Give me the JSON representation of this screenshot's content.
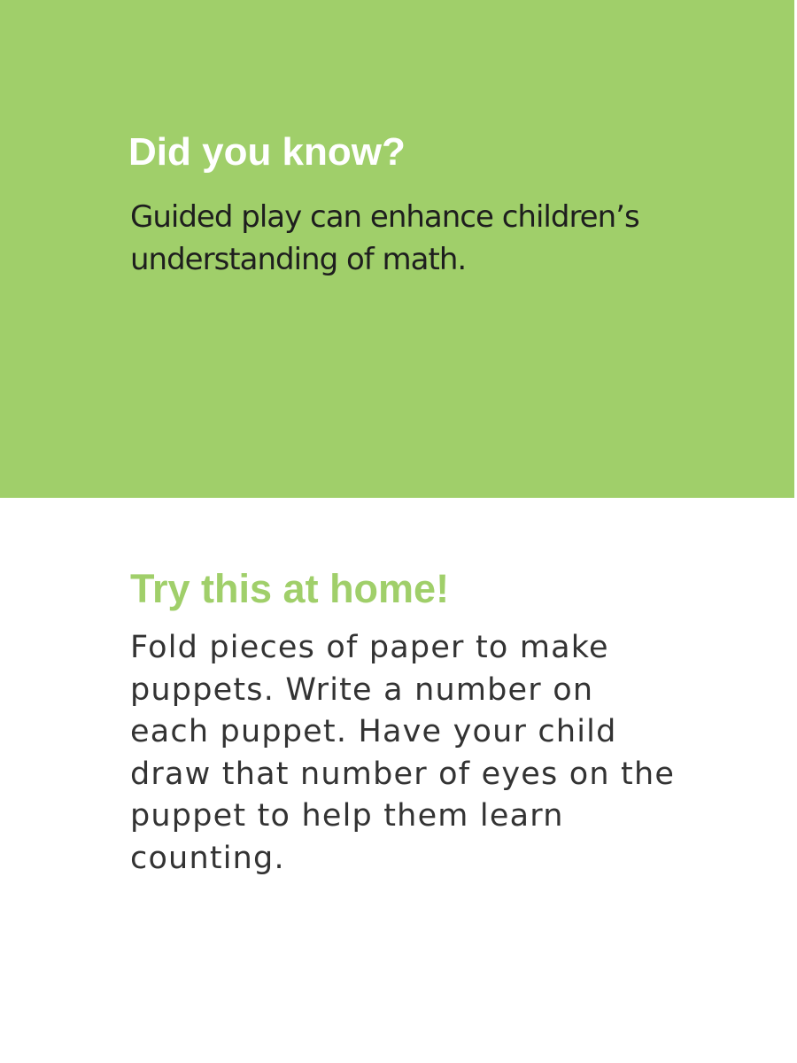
{
  "colors": {
    "accent_green": "#a0cf6a",
    "white": "#ffffff",
    "body_text": "#333333"
  },
  "did_you_know": {
    "heading": "Did you know?",
    "body_lines": [
      "Guided play can enhance children’s",
      "understanding of math."
    ]
  },
  "try_this": {
    "heading": "Try this at home!",
    "body_lines": [
      "Fold pieces of paper to make",
      "puppets. Write a number on",
      "each puppet. Have your child",
      "draw that number of eyes on the",
      "puppet to help them learn",
      "counting."
    ]
  }
}
